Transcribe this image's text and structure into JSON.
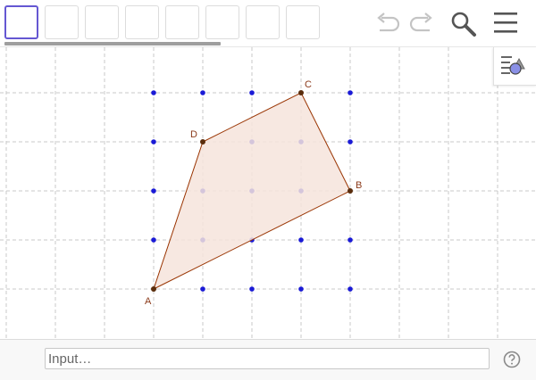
{
  "toolbar": {
    "tool_slots": 8,
    "selected_index": 0,
    "icons": [
      "undo-icon",
      "redo-icon",
      "search-icon",
      "menu-icon"
    ]
  },
  "graphics": {
    "points": [
      {
        "label": "A",
        "x": 0,
        "y": 0
      },
      {
        "label": "B",
        "x": 4,
        "y": 2
      },
      {
        "label": "C",
        "x": 3,
        "y": 4
      },
      {
        "label": "D",
        "x": 1,
        "y": 3
      }
    ],
    "polygon": [
      "A",
      "B",
      "C",
      "D"
    ],
    "lattice": {
      "x_range": [
        0,
        4
      ],
      "y_range": [
        0,
        4
      ]
    },
    "colors": {
      "polygon_stroke": "#993300",
      "polygon_fill": "#f6e4dc",
      "vertex": "#5a2d0c",
      "label": "#8b3a1a",
      "lattice_point": "#1a1ad6",
      "grid": "#c8c8c8",
      "tool_selected": "#6557d2"
    }
  },
  "input_bar": {
    "placeholder": "Input…",
    "help_icon": "help-icon"
  }
}
